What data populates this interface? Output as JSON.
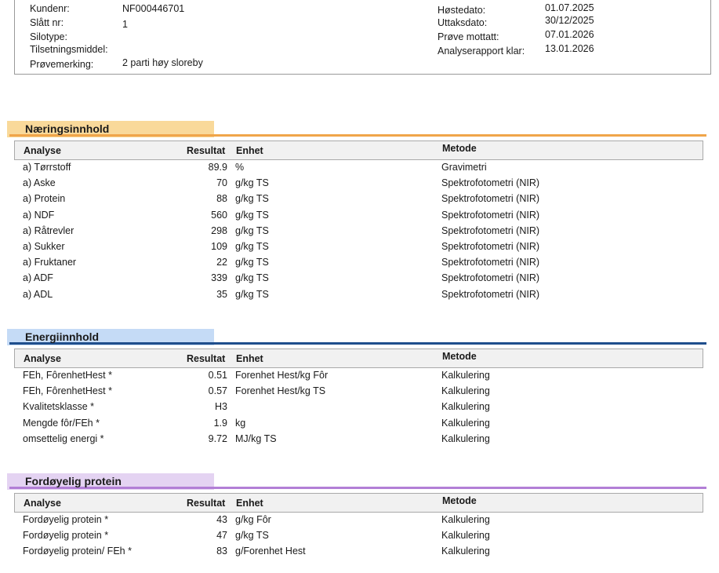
{
  "info": {
    "left": [
      {
        "label": "Kundenr:",
        "value": "NF000446701"
      },
      {
        "label": "Slått nr:",
        "value": "1"
      },
      {
        "label": "Silotype:",
        "value": ""
      },
      {
        "label": "Tilsetningsmiddel:",
        "value": ""
      },
      {
        "label": "Prøvemerking:",
        "value": "2 parti høy sloreby"
      }
    ],
    "right": [
      {
        "label": "Høstedato:",
        "value": "01.07.2025"
      },
      {
        "label": "Uttaksdato:",
        "value": "30/12/2025"
      },
      {
        "label": "Prøve mottatt:",
        "value": "07.01.2026"
      },
      {
        "label": "Analyserapport klar:",
        "value": "13.01.2026"
      }
    ]
  },
  "headers": {
    "analyse": "Analyse",
    "resultat": "Resultat",
    "enhet": "Enhet",
    "metode": "Metode"
  },
  "sections": [
    {
      "title": "Næringsinnhold",
      "bar_color": "#f9d99a",
      "line_color": "#f0a54a",
      "rows": [
        {
          "analyse": "a) Tørrstoff",
          "resultat": "89.9",
          "enhet": "%",
          "metode": "Gravimetri"
        },
        {
          "analyse": "a) Aske",
          "resultat": "70",
          "enhet": "g/kg TS",
          "metode": "Spektrofotometri (NIR)"
        },
        {
          "analyse": "a) Protein",
          "resultat": "88",
          "enhet": "g/kg TS",
          "metode": "Spektrofotometri (NIR)"
        },
        {
          "analyse": "a) NDF",
          "resultat": "560",
          "enhet": "g/kg TS",
          "metode": "Spektrofotometri (NIR)"
        },
        {
          "analyse": "a) Råtrevler",
          "resultat": "298",
          "enhet": "g/kg TS",
          "metode": "Spektrofotometri (NIR)"
        },
        {
          "analyse": "a) Sukker",
          "resultat": "109",
          "enhet": "g/kg TS",
          "metode": "Spektrofotometri (NIR)"
        },
        {
          "analyse": "a) Fruktaner",
          "resultat": "22",
          "enhet": "g/kg TS",
          "metode": "Spektrofotometri (NIR)"
        },
        {
          "analyse": "a) ADF",
          "resultat": "339",
          "enhet": "g/kg TS",
          "metode": "Spektrofotometri (NIR)"
        },
        {
          "analyse": "a) ADL",
          "resultat": "35",
          "enhet": "g/kg TS",
          "metode": "Spektrofotometri (NIR)"
        }
      ]
    },
    {
      "title": "Energiinnhold",
      "bar_color": "#c5dbf6",
      "line_color": "#1f4e8c",
      "rows": [
        {
          "analyse": "FEh, FôrenhetHest *",
          "resultat": "0.51",
          "enhet": "Forenhet Hest/kg Fôr",
          "metode": "Kalkulering"
        },
        {
          "analyse": "FEh, FôrenhetHest *",
          "resultat": "0.57",
          "enhet": "Forenhet Hest/kg TS",
          "metode": "Kalkulering"
        },
        {
          "analyse": "Kvalitetsklasse *",
          "resultat": "H3",
          "enhet": "",
          "metode": "Kalkulering"
        },
        {
          "analyse": "Mengde fôr/FEh *",
          "resultat": "1.9",
          "enhet": "kg",
          "metode": "Kalkulering"
        },
        {
          "analyse": "omsettelig energi *",
          "resultat": "9.72",
          "enhet": "MJ/kg TS",
          "metode": "Kalkulering"
        }
      ]
    },
    {
      "title": "Fordøyelig protein",
      "bar_color": "#e4d3f2",
      "line_color": "#b27fd6",
      "rows": [
        {
          "analyse": "Fordøyelig protein *",
          "resultat": "43",
          "enhet": "g/kg Fôr",
          "metode": "Kalkulering"
        },
        {
          "analyse": "Fordøyelig protein *",
          "resultat": "47",
          "enhet": "g/kg TS",
          "metode": "Kalkulering"
        },
        {
          "analyse": "Fordøyelig protein/ FEh *",
          "resultat": "83",
          "enhet": "g/Forenhet Hest",
          "metode": "Kalkulering"
        }
      ]
    }
  ]
}
